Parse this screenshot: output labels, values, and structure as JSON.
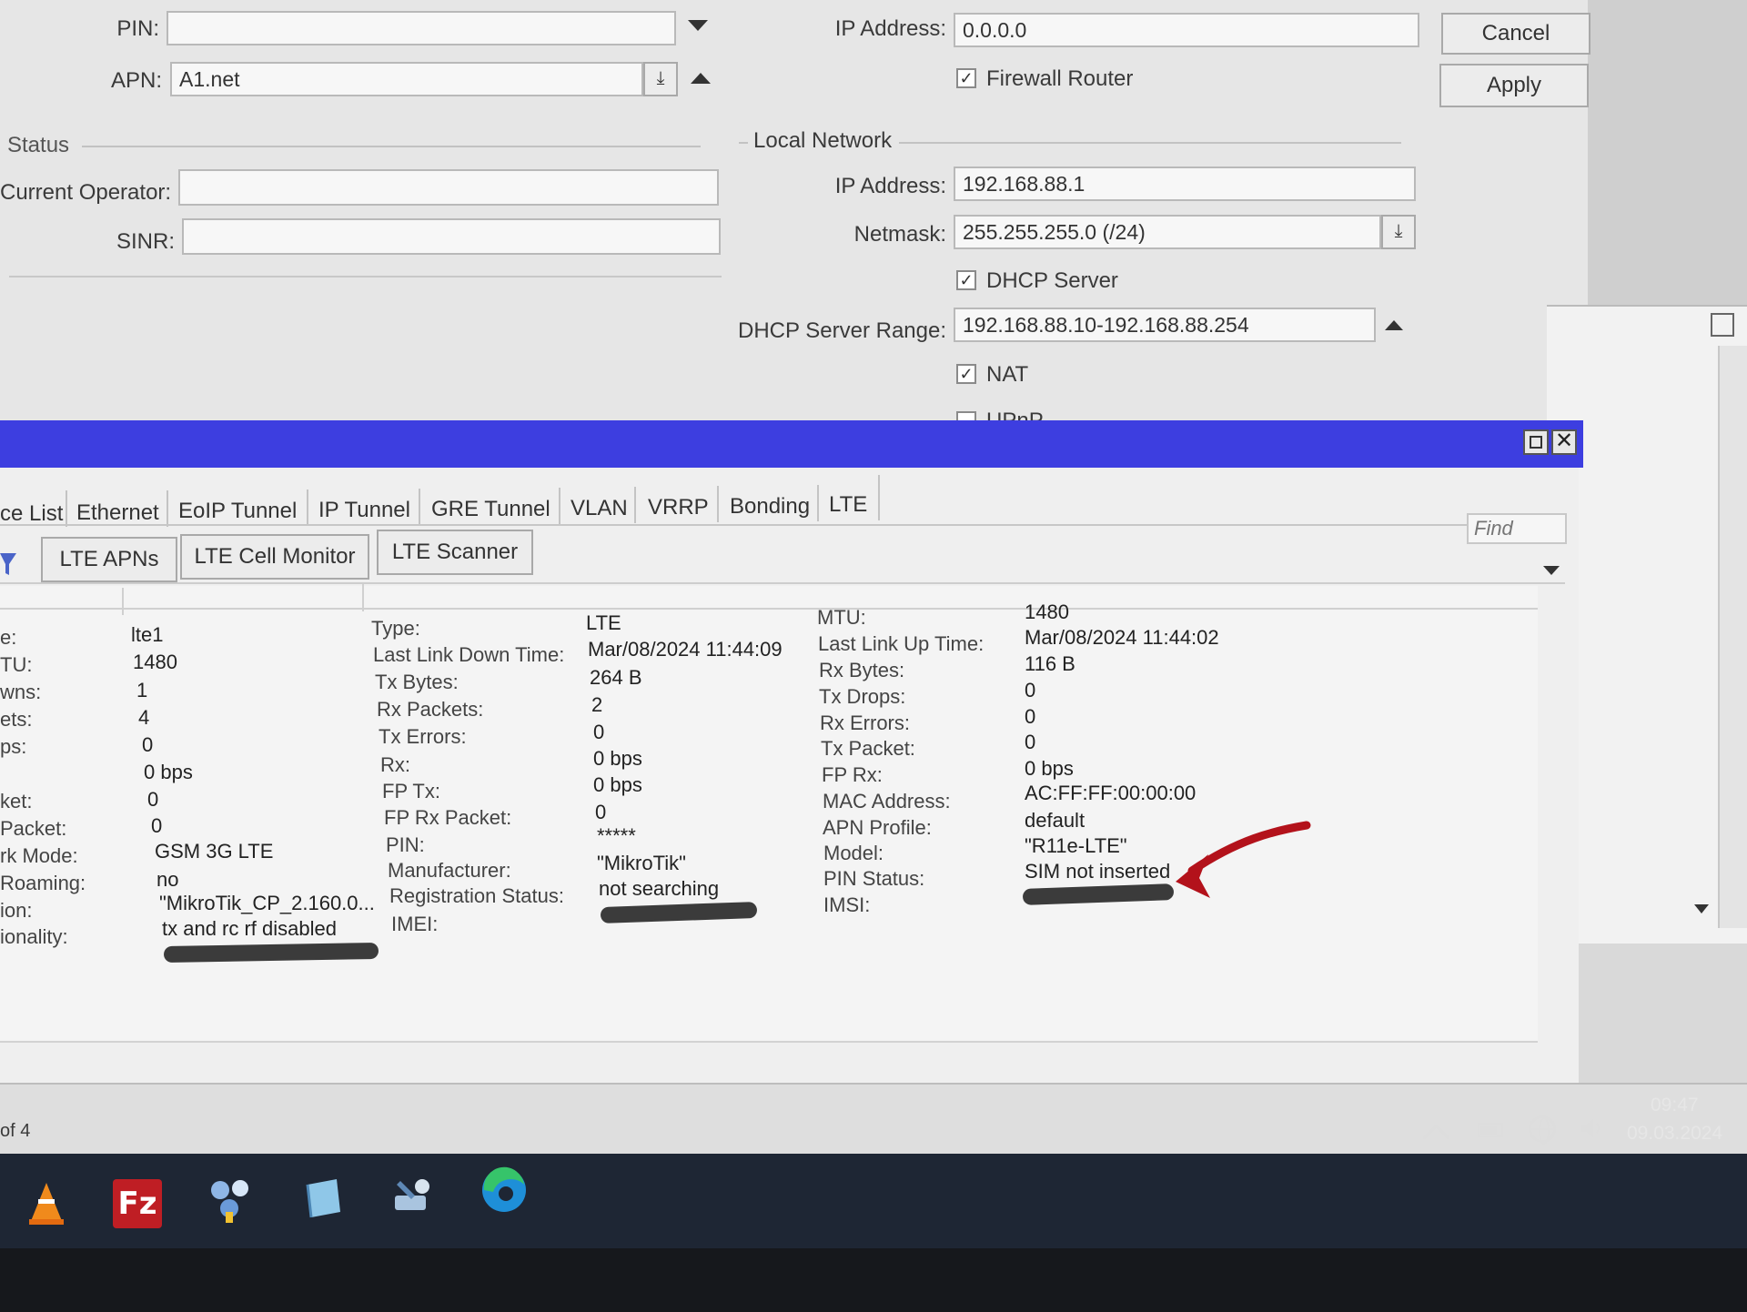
{
  "dialog": {
    "pin_label": "PIN:",
    "pin_value": "",
    "apn_label": "APN:",
    "apn_value": "A1.net",
    "ip_label": "IP Address:",
    "ip_value": "0.0.0.0",
    "firewall_label": "Firewall Router",
    "cancel_label": "Cancel",
    "apply_label": "Apply",
    "status_title": "Status",
    "operator_label": "Current Operator:",
    "sinr_label": "SINR:",
    "local_title": "Local Network",
    "local_ip_label": "IP Address:",
    "local_ip_value": "192.168.88.1",
    "netmask_label": "Netmask:",
    "netmask_value": "255.255.255.0 (/24)",
    "dhcp_label": "DHCP Server",
    "dhcp_range_label": "DHCP Server Range:",
    "dhcp_range_value": "192.168.88.10-192.168.88.254",
    "nat_label": "NAT",
    "upnp_label": "UPnP"
  },
  "tabs": [
    "ce List",
    "Ethernet",
    "EoIP Tunnel",
    "IP Tunnel",
    "GRE Tunnel",
    "VLAN",
    "VRRP",
    "Bonding",
    "LTE"
  ],
  "toolbar": {
    "lte_apns": "LTE APNs",
    "cell_monitor": "LTE Cell Monitor",
    "scanner": "LTE Scanner",
    "find_placeholder": "Find"
  },
  "details": {
    "col1": [
      {
        "k": "e:",
        "v": "lte1"
      },
      {
        "k": "TU:",
        "v": "1480"
      },
      {
        "k": "wns:",
        "v": "1"
      },
      {
        "k": "ets:",
        "v": "4"
      },
      {
        "k": "ps:",
        "v": "0"
      },
      {
        "k": "",
        "v": "0 bps"
      },
      {
        "k": "ket:",
        "v": "0"
      },
      {
        "k": "Packet:",
        "v": "0"
      },
      {
        "k": "rk Mode:",
        "v": "GSM 3G LTE"
      },
      {
        "k": "Roaming:",
        "v": "no"
      },
      {
        "k": "ion:",
        "v": "\"MikroTik_CP_2.160.0..."
      },
      {
        "k": "ionality:",
        "v": "tx and rc rf disabled"
      }
    ],
    "col2": [
      {
        "k": "Type:",
        "v": "LTE"
      },
      {
        "k": "Last Link Down Time:",
        "v": "Mar/08/2024 11:44:09"
      },
      {
        "k": "Tx Bytes:",
        "v": "264 B"
      },
      {
        "k": "Rx Packets:",
        "v": "2"
      },
      {
        "k": "Tx Errors:",
        "v": "0"
      },
      {
        "k": "Rx:",
        "v": "0 bps"
      },
      {
        "k": "FP Tx:",
        "v": "0 bps"
      },
      {
        "k": "FP Rx Packet:",
        "v": "0"
      },
      {
        "k": "PIN:",
        "v": "*****"
      },
      {
        "k": "Manufacturer:",
        "v": "\"MikroTik\""
      },
      {
        "k": "Registration Status:",
        "v": "not searching"
      },
      {
        "k": "IMEI:",
        "v": ""
      }
    ],
    "col3": [
      {
        "k": "MTU:",
        "v": "1480"
      },
      {
        "k": "Last Link Up Time:",
        "v": "Mar/08/2024 11:44:02"
      },
      {
        "k": "Rx Bytes:",
        "v": "116 B"
      },
      {
        "k": "Tx Drops:",
        "v": "0"
      },
      {
        "k": "Rx Errors:",
        "v": "0"
      },
      {
        "k": "Tx Packet:",
        "v": "0"
      },
      {
        "k": "FP Rx:",
        "v": "0 bps"
      },
      {
        "k": "MAC Address:",
        "v": "AC:FF:FF:00:00:00"
      },
      {
        "k": "APN Profile:",
        "v": "default"
      },
      {
        "k": "Model:",
        "v": "\"R11e-LTE\""
      },
      {
        "k": "PIN Status:",
        "v": "SIM not inserted"
      },
      {
        "k": "IMSI:",
        "v": ""
      }
    ]
  },
  "status_bar": {
    "count": "of 4"
  },
  "tray": {
    "time": "09:47",
    "date": "09.03.2024"
  },
  "colors": {
    "titlebar": "#3d3ee0",
    "annotation_arrow": "#b3121b"
  }
}
